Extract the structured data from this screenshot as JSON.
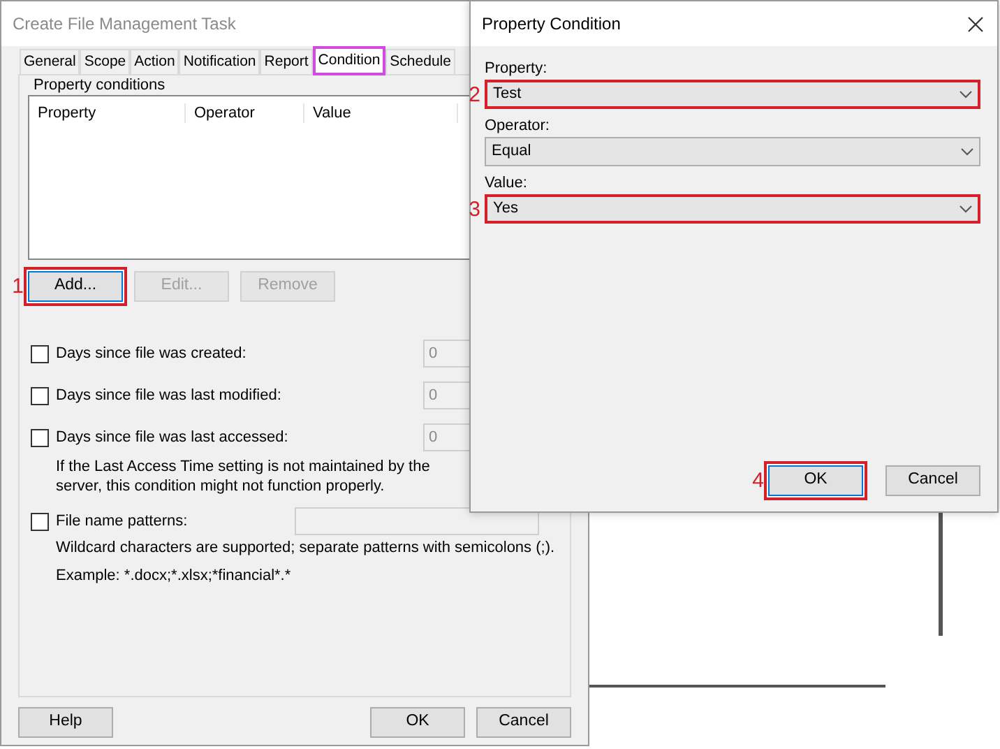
{
  "main_window": {
    "title": "Create File Management Task",
    "tabs": [
      {
        "label": "General",
        "selected": false,
        "highlighted": false
      },
      {
        "label": "Scope",
        "selected": false,
        "highlighted": false
      },
      {
        "label": "Action",
        "selected": false,
        "highlighted": false
      },
      {
        "label": "Notification",
        "selected": false,
        "highlighted": false
      },
      {
        "label": "Report",
        "selected": false,
        "highlighted": false
      },
      {
        "label": "Condition",
        "selected": true,
        "highlighted": true
      },
      {
        "label": "Schedule",
        "selected": false,
        "highlighted": false
      }
    ],
    "property_conditions": {
      "title": "Property conditions",
      "columns": [
        "Property",
        "Operator",
        "Value"
      ],
      "buttons": [
        {
          "label": "Add...",
          "disabled": false,
          "highlighted": true,
          "step": "1"
        },
        {
          "label": "Edit...",
          "disabled": true,
          "highlighted": false
        },
        {
          "label": "Remove",
          "disabled": true,
          "highlighted": false
        }
      ]
    },
    "date_conditions": [
      {
        "label": "Days since file was created:",
        "checked": false,
        "value": "0",
        "disabled": true
      },
      {
        "label": "Days since file was last modified:",
        "checked": false,
        "value": "0",
        "disabled": true
      },
      {
        "label": "Days since file was last accessed:",
        "checked": false,
        "value": "0",
        "disabled": true
      }
    ],
    "access_note": "If the Last Access Time setting is not maintained by the server, this condition might not function properly.",
    "file_name_patterns": {
      "label": "File name patterns:",
      "checked": false,
      "hint": "Wildcard characters are supported; separate patterns with semicolons (;).",
      "example": "Example: *.docx;*.xlsx;*financial*.*"
    },
    "buttons": [
      {
        "label": "Help"
      },
      {
        "label": "OK"
      },
      {
        "label": "Cancel"
      }
    ]
  },
  "property_dialog": {
    "title": "Property Condition",
    "fields": [
      {
        "label": "Property:",
        "value": "Test",
        "highlighted": true,
        "step": "2"
      },
      {
        "label": "Operator:",
        "value": "Equal",
        "highlighted": false
      },
      {
        "label": "Value:",
        "value": "Yes",
        "highlighted": true,
        "step": "3"
      }
    ],
    "buttons": [
      {
        "label": "OK",
        "highlighted": true,
        "step": "4"
      },
      {
        "label": "Cancel",
        "highlighted": false
      }
    ]
  }
}
